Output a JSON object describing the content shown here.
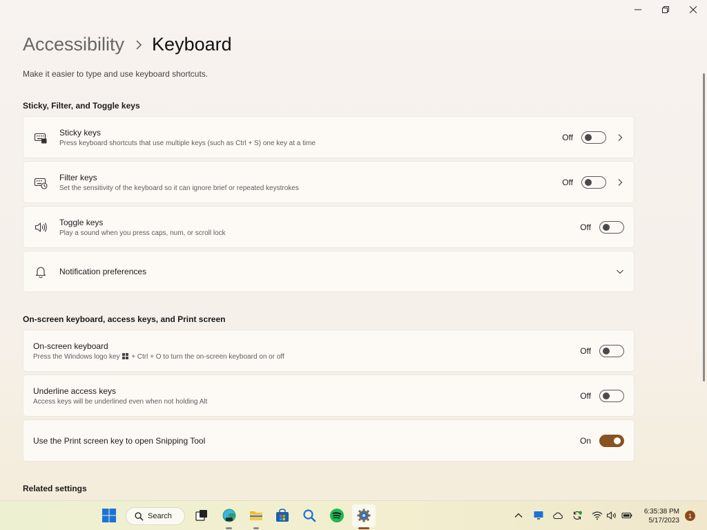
{
  "breadcrumb": {
    "parent": "Accessibility",
    "current": "Keyboard"
  },
  "subtitle": "Make it easier to type and use keyboard shortcuts.",
  "sections": {
    "sticky": "Sticky, Filter, and Toggle keys",
    "onscreen": "On-screen keyboard, access keys, and Print screen",
    "related": "Related settings"
  },
  "sticky_keys": {
    "title": "Sticky keys",
    "desc": "Press keyboard shortcuts that use multiple keys (such as Ctrl + S) one key at a time",
    "state": "Off",
    "icon": "keyboard-sticky-icon"
  },
  "filter_keys": {
    "title": "Filter keys",
    "desc": "Set the sensitivity of the keyboard so it can ignore brief or repeated keystrokes",
    "state": "Off",
    "icon": "keyboard-filter-icon"
  },
  "toggle_keys": {
    "title": "Toggle keys",
    "desc": "Play a sound when you press caps, num, or scroll lock",
    "state": "Off",
    "icon": "speaker-icon"
  },
  "notification_prefs": {
    "title": "Notification preferences",
    "icon": "bell-icon"
  },
  "onscreen_keyboard": {
    "title": "On-screen keyboard",
    "desc_before": "Press the Windows logo key",
    "desc_after": "+ Ctrl + O to turn the on-screen keyboard on or off",
    "state": "Off"
  },
  "underline_keys": {
    "title": "Underline access keys",
    "desc": "Access keys will be underlined even when not holding Alt",
    "state": "Off"
  },
  "print_screen": {
    "title": "Use the Print screen key to open Snipping Tool",
    "state": "On"
  },
  "taskbar": {
    "search_label": "Search",
    "clock_time": "6:35:38 PM",
    "clock_date": "5/17/2023",
    "notification_count": "1"
  },
  "colors": {
    "accent": "#8a5220",
    "badge": "#8a4a18"
  }
}
